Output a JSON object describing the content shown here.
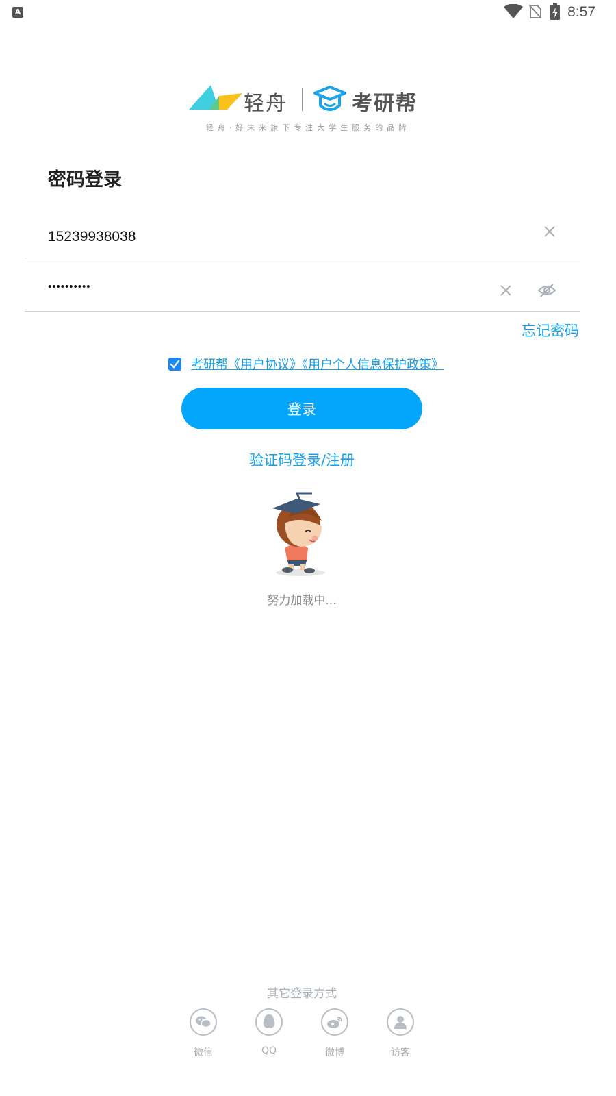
{
  "status_bar": {
    "time": "8:57"
  },
  "brand": {
    "qingzhou_name": "轻舟",
    "kaoyanbang_name": "考研帮",
    "tagline": "轻舟·好未来旗下专注大学生服务的品牌"
  },
  "login": {
    "heading": "密码登录",
    "phone_value": "15239938038",
    "password_value": "••••••••••",
    "forgot_password": "忘记密码",
    "agreement_text": "考研帮《用户协议》《用户个人信息保护政策》",
    "agreement_checked": true,
    "login_button": "登录",
    "sms_login_link": "验证码登录/注册"
  },
  "loading": {
    "text": "努力加载中..."
  },
  "other_login": {
    "title": "其它登录方式",
    "methods": [
      {
        "icon": "wechat-icon",
        "label": "微信"
      },
      {
        "icon": "qq-icon",
        "label": "QQ"
      },
      {
        "icon": "weibo-icon",
        "label": "微博"
      },
      {
        "icon": "guest-icon",
        "label": "访客"
      }
    ]
  },
  "colors": {
    "accent": "#03a6fb",
    "link": "#16a0e8",
    "checkbox": "#1c86f0",
    "brand_cyan": "#3ed0e0",
    "brand_yellow": "#f8c21a"
  }
}
